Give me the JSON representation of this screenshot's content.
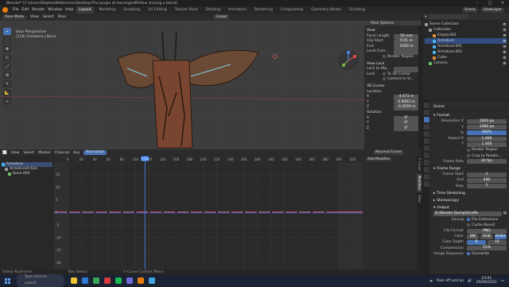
{
  "window": {
    "title": "Blender* [C:\\Users\\StephenMcKechnie\\Desktop\\The Jungle at home\\giraffe\\four tracing a.blend]",
    "controls": [
      "–",
      "□",
      "✕"
    ]
  },
  "menubar": {
    "menus": [
      "File",
      "Edit",
      "Render",
      "Window",
      "Help"
    ],
    "workspaces": [
      "Layout",
      "Modeling",
      "Sculpting",
      "UV Editing",
      "Texture Paint",
      "Shading",
      "Animation",
      "Rendering",
      "Compositing",
      "Geometry Nodes",
      "Scripting"
    ],
    "active_workspace": "Layout",
    "scene": "Scene",
    "view_layer": "ViewLayer"
  },
  "viewport": {
    "header": [
      "Pose Mode",
      "View",
      "Select",
      "Pose"
    ],
    "transform_orientation": "Global",
    "info_lines": [
      "User Perspective",
      "(114) Armature | Bone"
    ],
    "toolbar_icons": [
      "cursor-icon",
      "select-box-icon",
      "move-icon",
      "rotate-icon",
      "scale-icon",
      "transform-icon",
      "annotate-icon",
      "measure-icon",
      "pose-relax-icon"
    ],
    "pose_options_label": "Pose Options",
    "npanel": {
      "view_title": "View",
      "focal_length_label": "Focal Length",
      "focal_length": "50 mm",
      "clip_start_label": "Clip Start",
      "clip_start": "0.01 m",
      "clip_end_label": "End",
      "clip_end": "1000 m",
      "local_camera_label": "Local Cam...",
      "render_region": "Render Region",
      "view_lock_title": "View Lock",
      "lock_to_object_label": "Lock to Obj...",
      "lock_label": "Lock",
      "lock_to_cursor": "To 3D Cursor",
      "camera_to_view": "Camera to Vi...",
      "cursor_title": "3D Cursor",
      "location_label": "Location",
      "cursor_x": "4.673 m",
      "cursor_y": "0.9093 m",
      "cursor_z": "-0.2059 m",
      "rotation_label": "Rotation",
      "rot_x": "0°",
      "rot_y": "0°",
      "rot_z": "0°"
    }
  },
  "outliner": {
    "header_label": "Scene Collection",
    "items": [
      {
        "label": "Scene Collection",
        "indent": 0,
        "color": "#9a9a9a"
      },
      {
        "label": "Collection",
        "indent": 1,
        "color": "#9a9a9a"
      },
      {
        "label": "Empty.001",
        "indent": 2,
        "color": "#e08f3a"
      },
      {
        "label": "Armature",
        "indent": 2,
        "color": "#48b6f0",
        "selected": true
      },
      {
        "label": "Armature.001",
        "indent": 2,
        "color": "#48b6f0"
      },
      {
        "label": "Armature.002",
        "indent": 2,
        "color": "#48b6f0"
      },
      {
        "label": "Cube",
        "indent": 2,
        "color": "#e08f3a"
      },
      {
        "label": "Camera",
        "indent": 1,
        "color": "#6bc26b"
      }
    ]
  },
  "properties": {
    "header": "Scene",
    "format_title": "Format",
    "resolution_x_label": "Resolution X",
    "resolution_x": "1920 px",
    "resolution_y_label": "Y",
    "resolution_y": "1080 px",
    "resolution_pct": "100%",
    "aspect_x_label": "Aspect X",
    "aspect_x": "1.000",
    "aspect_y_label": "Y",
    "aspect_y": "1.000",
    "render_region": "Render Region",
    "crop": "Crop to Render...",
    "frame_rate_label": "Frame Rate",
    "frame_rate": "24 fps",
    "frame_range_title": "Frame Range",
    "frame_start_label": "Frame Start",
    "frame_start": "1",
    "frame_end_label": "End",
    "frame_end": "400",
    "frame_step_label": "Step",
    "frame_step": "1",
    "time_stretching": "Time Stretching",
    "stereoscopy": "Stereoscopy",
    "output_title": "Output",
    "output_path": "D:\\Render Dump\\Giraffe",
    "saving_label": "Saving",
    "file_extensions": "File Extensions",
    "cache_result": "Cache Result",
    "file_format_label": "File Format",
    "file_format": "PNG",
    "color_label": "Color",
    "color_options": [
      "BW",
      "RGB",
      "RGBA"
    ],
    "color_selected": "RGBA",
    "color_depth_label": "Color Depth",
    "color_depth_options": [
      "8",
      "16"
    ],
    "color_depth_selected": "8",
    "compression_label": "Compression",
    "compression": "15%",
    "image_sequence_label": "Image Sequence",
    "overwrite": "Overwrite"
  },
  "graph_editor": {
    "header": [
      "View",
      "Select",
      "Marker",
      "Channel",
      "Key"
    ],
    "normalize": "Normalize",
    "current_frame": "114",
    "frame_ticks": [
      "0",
      "20",
      "40",
      "60",
      "80",
      "100",
      "120",
      "140",
      "160",
      "180",
      "200",
      "220",
      "240",
      "260",
      "280",
      "300",
      "320",
      "340",
      "360",
      "380",
      "400",
      "420"
    ],
    "value_ticks": [
      "15",
      "10",
      "5",
      "0",
      "-5",
      "-10",
      "-15",
      "-20"
    ],
    "channels": [
      {
        "label": "Armature",
        "indent": 0,
        "color": "#48b6f0"
      },
      {
        "label": "ArmatureAction",
        "indent": 1,
        "color": "#9a9a9a"
      },
      {
        "label": "Bone.004",
        "indent": 2,
        "color": "#6bc26b"
      }
    ],
    "right_panel": {
      "pivot": "Nearest Frame",
      "add_modifier": "Add Modifier",
      "tabs": [
        "F-Curve",
        "Modifiers",
        "View"
      ],
      "active_tab": "Modifiers"
    },
    "status": [
      "Select Keyframe",
      "Box Select",
      "F-Curve Context Menu"
    ]
  },
  "taskbar": {
    "search_placeholder": "Type here to search",
    "weather": "Rain off and on",
    "time": "23:01",
    "date": "29/06/2022",
    "apps": [
      "#f0c330",
      "#2f7ad6",
      "#3aa757",
      "#d93a3a",
      "#1db954",
      "#6b6bd8",
      "#e87d0d",
      "#45a5e0"
    ]
  }
}
